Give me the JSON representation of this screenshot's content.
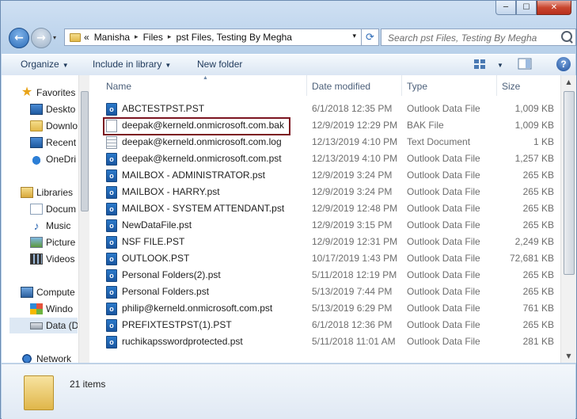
{
  "window": {
    "caption_buttons": {
      "minimize": "─",
      "maximize": "☐",
      "close": "✕"
    }
  },
  "address": {
    "history_glyph": "▾",
    "overflow": "«",
    "crumbs": [
      "Manisha",
      "Files",
      "pst Files, Testing By Megha"
    ],
    "separator": "▸",
    "refresh_glyph": "⟳"
  },
  "search": {
    "placeholder": "Search pst Files, Testing By Megha"
  },
  "toolbar": {
    "organize": "Organize",
    "include_in_library": "Include in library",
    "new_folder": "New folder",
    "help": "?"
  },
  "sidebar": {
    "favorites": "Favorites",
    "desktop": "Deskto",
    "downloads": "Downlo",
    "recent": "Recent",
    "onedrive": "OneDri",
    "libraries": "Libraries",
    "documents": "Docum",
    "music": "Music",
    "pictures": "Picture",
    "videos": "Videos",
    "computer": "Compute",
    "windows": "Windo",
    "data": "Data (D",
    "network": "Network"
  },
  "columns": {
    "name": "Name",
    "date": "Date modified",
    "type": "Type",
    "size": "Size"
  },
  "files": [
    {
      "name": "ABCTESTPST.PST",
      "date": "6/1/2018 12:35 PM",
      "type": "Outlook Data File",
      "size": "1,009 KB",
      "icon": "pst"
    },
    {
      "name": "deepak@kerneld.onmicrosoft.com.bak",
      "date": "12/9/2019 12:29 PM",
      "type": "BAK File",
      "size": "1,009 KB",
      "icon": "blank"
    },
    {
      "name": "deepak@kerneld.onmicrosoft.com.log",
      "date": "12/13/2019 4:10 PM",
      "type": "Text Document",
      "size": "1 KB",
      "icon": "txt"
    },
    {
      "name": "deepak@kerneld.onmicrosoft.com.pst",
      "date": "12/13/2019 4:10 PM",
      "type": "Outlook Data File",
      "size": "1,257 KB",
      "icon": "pst"
    },
    {
      "name": "MAILBOX - ADMINISTRATOR.pst",
      "date": "12/9/2019 3:24 PM",
      "type": "Outlook Data File",
      "size": "265 KB",
      "icon": "pst"
    },
    {
      "name": "MAILBOX - HARRY.pst",
      "date": "12/9/2019 3:24 PM",
      "type": "Outlook Data File",
      "size": "265 KB",
      "icon": "pst"
    },
    {
      "name": "MAILBOX - SYSTEM ATTENDANT.pst",
      "date": "12/9/2019 12:48 PM",
      "type": "Outlook Data File",
      "size": "265 KB",
      "icon": "pst"
    },
    {
      "name": "NewDataFile.pst",
      "date": "12/9/2019 3:15 PM",
      "type": "Outlook Data File",
      "size": "265 KB",
      "icon": "pst"
    },
    {
      "name": "NSF FILE.PST",
      "date": "12/9/2019 12:31 PM",
      "type": "Outlook Data File",
      "size": "2,249 KB",
      "icon": "pst"
    },
    {
      "name": "OUTLOOK.PST",
      "date": "10/17/2019 1:43 PM",
      "type": "Outlook Data File",
      "size": "72,681 KB",
      "icon": "pst"
    },
    {
      "name": "Personal Folders(2).pst",
      "date": "5/11/2018 12:19 PM",
      "type": "Outlook Data File",
      "size": "265 KB",
      "icon": "pst"
    },
    {
      "name": "Personal Folders.pst",
      "date": "5/13/2019 7:44 PM",
      "type": "Outlook Data File",
      "size": "265 KB",
      "icon": "pst"
    },
    {
      "name": "philip@kerneld.onmicrosoft.com.pst",
      "date": "5/13/2019 6:29 PM",
      "type": "Outlook Data File",
      "size": "761 KB",
      "icon": "pst"
    },
    {
      "name": "PREFIXTESTPST(1).PST",
      "date": "6/1/2018 12:36 PM",
      "type": "Outlook Data File",
      "size": "265 KB",
      "icon": "pst"
    },
    {
      "name": "ruchikapsswordprotected.pst",
      "date": "5/11/2018 11:01 AM",
      "type": "Outlook Data File",
      "size": "281 KB",
      "icon": "pst"
    }
  ],
  "status": {
    "count": "21 items"
  }
}
